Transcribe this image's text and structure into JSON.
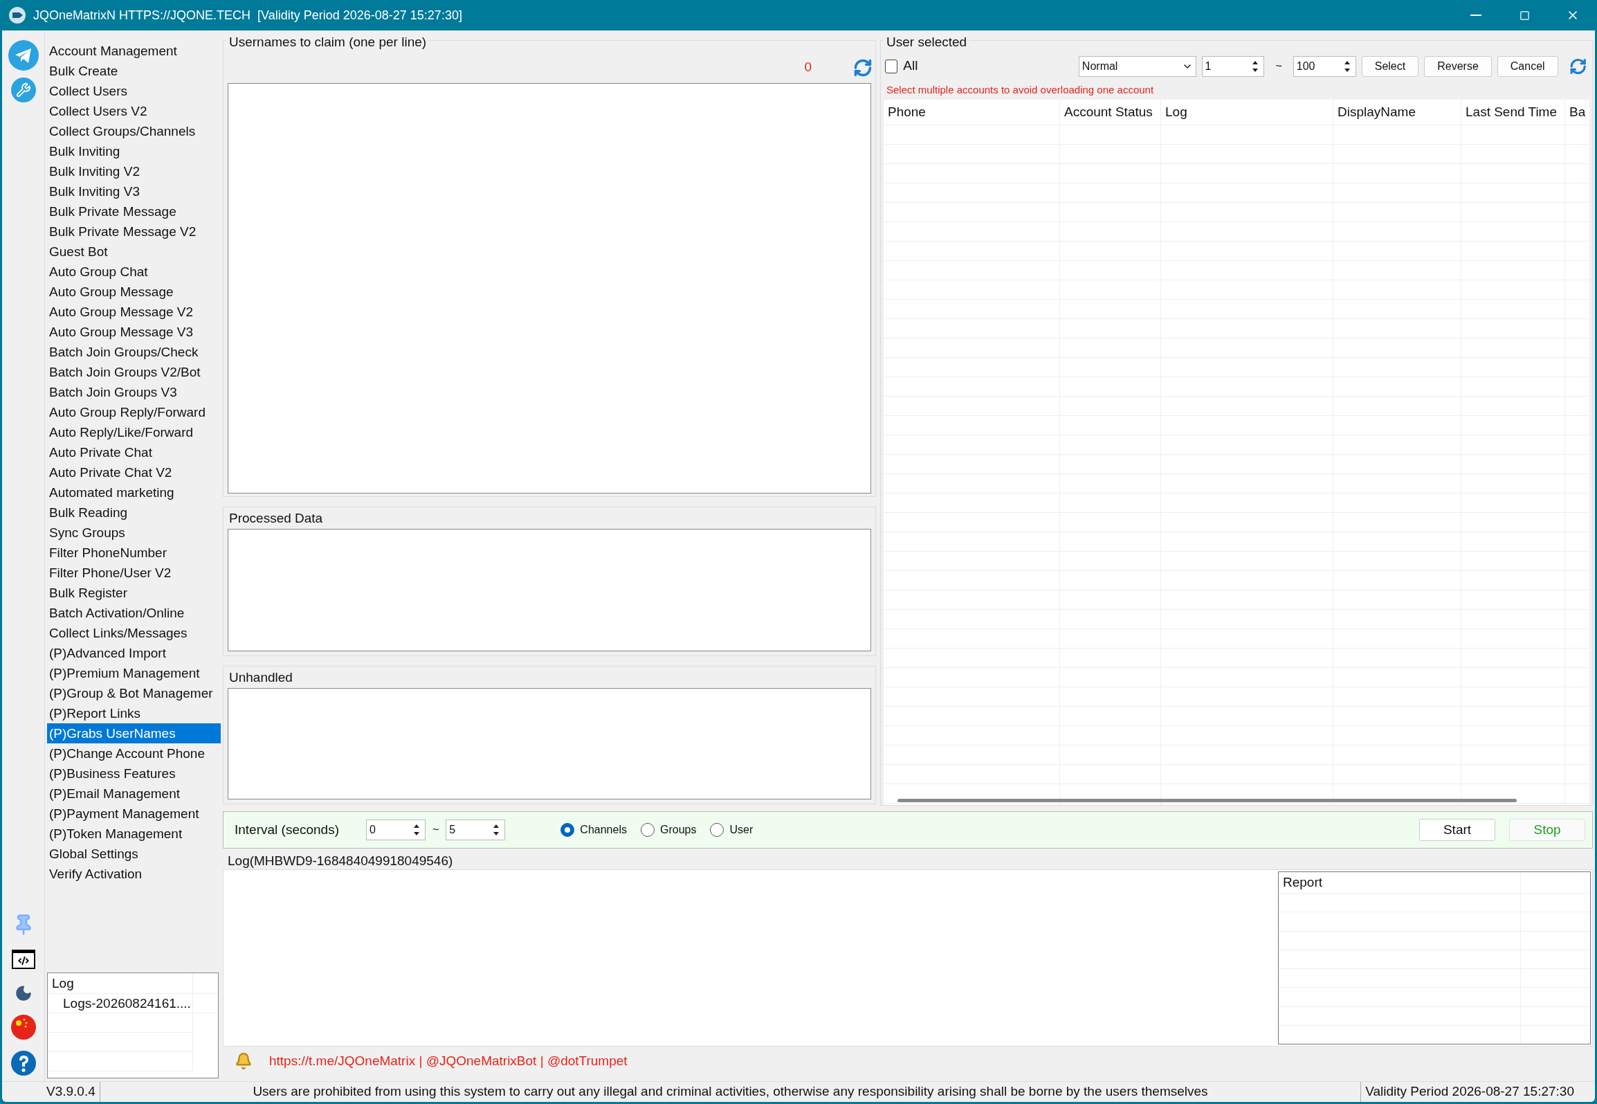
{
  "window": {
    "title": "JQOneMatrixN HTTPS://JQONE.TECH  [Validity Period 2026-08-27 15:27:30]"
  },
  "sidebar": {
    "items": [
      {
        "label": "Account Management",
        "selected": false
      },
      {
        "label": "Bulk Create",
        "selected": false
      },
      {
        "label": "Collect Users",
        "selected": false
      },
      {
        "label": "Collect Users V2",
        "selected": false
      },
      {
        "label": "Collect Groups/Channels",
        "selected": false
      },
      {
        "label": "Bulk Inviting",
        "selected": false
      },
      {
        "label": "Bulk Inviting V2",
        "selected": false
      },
      {
        "label": "Bulk Inviting V3",
        "selected": false
      },
      {
        "label": "Bulk Private Message",
        "selected": false
      },
      {
        "label": "Bulk Private Message V2",
        "selected": false
      },
      {
        "label": "Guest Bot",
        "selected": false
      },
      {
        "label": "Auto Group Chat",
        "selected": false
      },
      {
        "label": "Auto Group Message",
        "selected": false
      },
      {
        "label": "Auto Group Message V2",
        "selected": false
      },
      {
        "label": "Auto Group Message V3",
        "selected": false
      },
      {
        "label": "Batch Join Groups/Check",
        "selected": false
      },
      {
        "label": "Batch Join Groups V2/Bot",
        "selected": false
      },
      {
        "label": "Batch Join Groups V3",
        "selected": false
      },
      {
        "label": "Auto Group Reply/Forward",
        "selected": false
      },
      {
        "label": "Auto Reply/Like/Forward",
        "selected": false
      },
      {
        "label": "Auto Private Chat",
        "selected": false
      },
      {
        "label": "Auto Private Chat V2",
        "selected": false
      },
      {
        "label": "Automated marketing",
        "selected": false
      },
      {
        "label": "Bulk Reading",
        "selected": false
      },
      {
        "label": "Sync Groups",
        "selected": false
      },
      {
        "label": "Filter PhoneNumber",
        "selected": false
      },
      {
        "label": "Filter Phone/User V2",
        "selected": false
      },
      {
        "label": "Bulk Register",
        "selected": false
      },
      {
        "label": "Batch Activation/Online",
        "selected": false
      },
      {
        "label": "Collect Links/Messages",
        "selected": false
      },
      {
        "label": "(P)Advanced Import",
        "selected": false
      },
      {
        "label": "(P)Premium Management",
        "selected": false
      },
      {
        "label": "(P)Group & Bot Managemer",
        "selected": false
      },
      {
        "label": "(P)Report Links",
        "selected": false
      },
      {
        "label": "(P)Grabs UserNames",
        "selected": true
      },
      {
        "label": "(P)Change Account Phone",
        "selected": false
      },
      {
        "label": "(P)Business Features",
        "selected": false
      },
      {
        "label": "(P)Email Management",
        "selected": false
      },
      {
        "label": "(P)Payment Management",
        "selected": false
      },
      {
        "label": "(P)Token Management",
        "selected": false
      },
      {
        "label": "Global Settings",
        "selected": false
      },
      {
        "label": "Verify Activation",
        "selected": false
      }
    ],
    "log": {
      "header": "Log",
      "rows": [
        "Logs-20260824161...."
      ]
    }
  },
  "usernames": {
    "title": "Usernames to claim (one per line)",
    "count": "0"
  },
  "processed": {
    "title": "Processed Data"
  },
  "unhandled": {
    "title": "Unhandled"
  },
  "user_selected": {
    "title": "User selected",
    "all": {
      "label": "All",
      "checked": false
    },
    "mode": "Normal",
    "from": "1",
    "to": "100",
    "tilde": "~",
    "buttons": [
      "Select",
      "Reverse",
      "Cancel"
    ],
    "hint": "Select multiple accounts to avoid overloading one account",
    "columns": [
      "Phone",
      "Account Status",
      "Log",
      "DisplayName",
      "Last Send Time",
      "Ba"
    ]
  },
  "interval": {
    "label": "Interval (seconds)",
    "from": "0",
    "to": "5",
    "tilde": "~",
    "targets": [
      {
        "label": "Channels",
        "selected": true
      },
      {
        "label": "Groups",
        "selected": false
      },
      {
        "label": "User",
        "selected": false
      }
    ],
    "start": "Start",
    "stop": "Stop"
  },
  "log": {
    "title": "Log(MHBWD9-168484049918049546)",
    "report_header": "Report"
  },
  "footer": {
    "links": "https://t.me/JQOneMatrix | @JQOneMatrixBot | @dotTrumpet"
  },
  "status_bar": {
    "version": "V3.9.0.4",
    "notice": "Users are prohibited from using this system to carry out any illegal and criminal activities, otherwise any responsibility arising shall be borne by the users themselves",
    "validity": "Validity Period 2026-08-27 15:27:30"
  }
}
